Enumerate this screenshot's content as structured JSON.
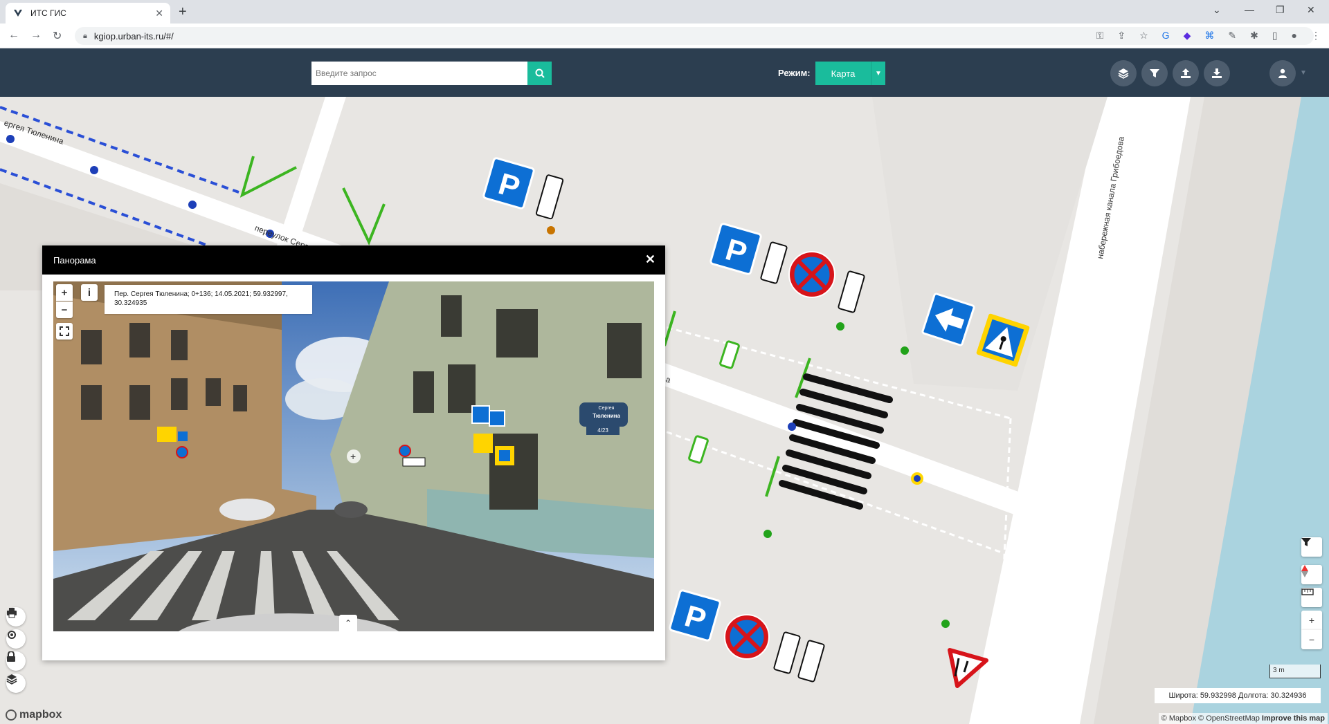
{
  "browser": {
    "tab_title": "ИТС ГИС",
    "url": "kgiop.urban-its.ru/#/"
  },
  "header": {
    "search_placeholder": "Введите запрос",
    "mode_label": "Режим:",
    "mode_value": "Карта"
  },
  "map": {
    "street_labels": [
      "ергея Тюленина",
      "переулок Серг",
      "набережная канала Грибоедова",
      "а"
    ],
    "scale_label": "3 m",
    "coords_label": "Широта: 59.932998  Долгота: 30.324936",
    "attribution_mapbox": "© Mapbox",
    "attribution_osm": "© OpenStreetMap",
    "attribution_improve": "Improve this map",
    "logo_text": "mapbox"
  },
  "panorama": {
    "title": "Панорама",
    "info_text": "Пер. Сергея Тюленина; 0+136; 14.05.2021; 59.932997, 30.324935",
    "zoom_in": "+",
    "zoom_out": "−",
    "info_button": "i",
    "plaque_line1": "Сергея",
    "plaque_line2": "Тюленина",
    "plaque_line3": "4/23"
  },
  "icons": {
    "search": "search-icon",
    "layers": "layers-icon",
    "filter": "filter-icon",
    "upload": "upload-icon",
    "download": "download-icon",
    "user": "user-icon",
    "print": "print-icon",
    "locate": "locate-icon",
    "lock": "lock-icon",
    "compass": "compass-icon",
    "ruler": "ruler-icon"
  },
  "colors": {
    "header_bg": "#2c3e50",
    "accent": "#1abc9c",
    "water": "#aad3df",
    "sign_blue": "#0d6fd4",
    "sign_red": "#d7141a"
  }
}
